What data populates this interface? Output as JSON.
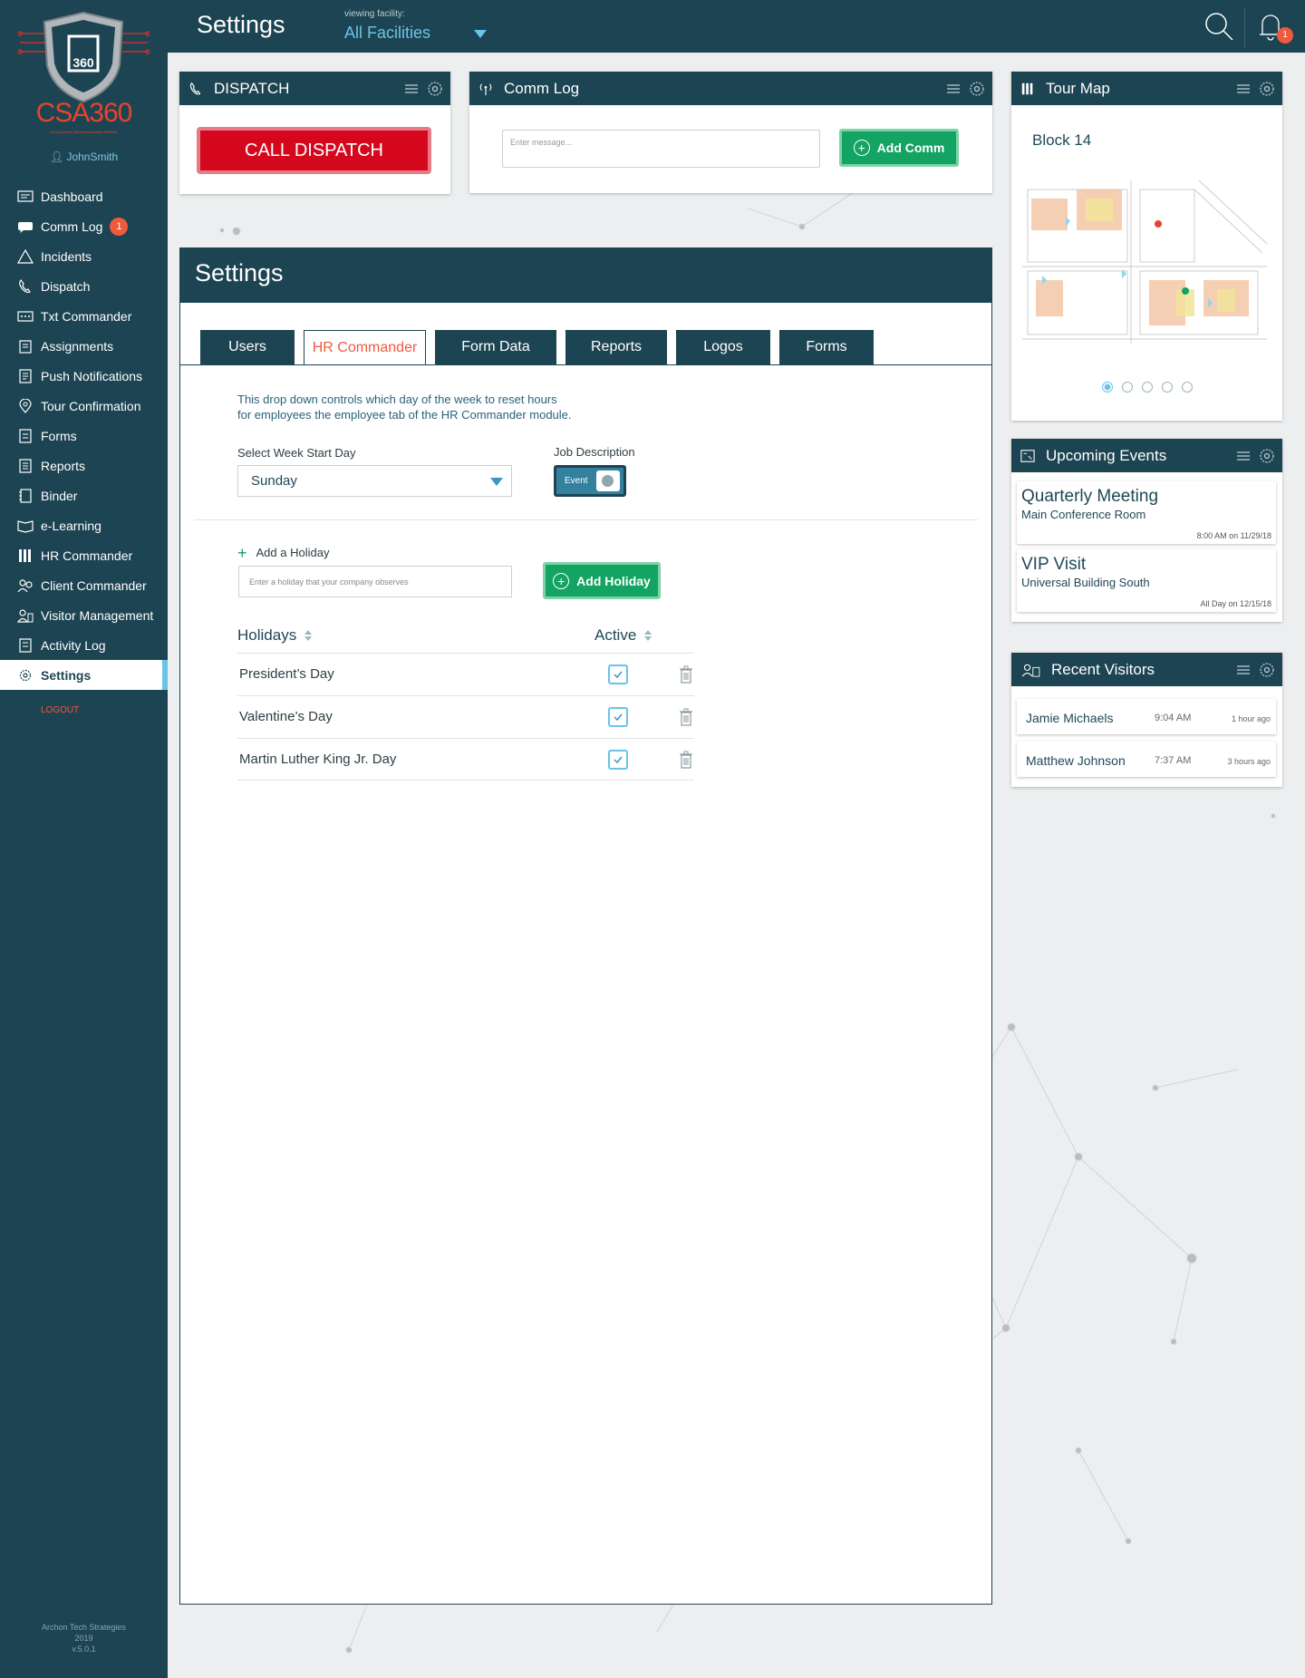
{
  "sidebar": {
    "brand": "CSA360",
    "brand_sub": "Ground Level Client Assessment Platform",
    "user": "JohnSmith",
    "items": [
      {
        "label": "Dashboard",
        "icon": "dashboard-icon"
      },
      {
        "label": "Comm Log",
        "icon": "chat-icon",
        "badge": "1"
      },
      {
        "label": "Incidents",
        "icon": "warning-icon"
      },
      {
        "label": "Dispatch",
        "icon": "phone-icon"
      },
      {
        "label": "Txt Commander",
        "icon": "message-dots-icon"
      },
      {
        "label": "Assignments",
        "icon": "clipboard-icon"
      },
      {
        "label": "Push Notifications",
        "icon": "document-icon"
      },
      {
        "label": "Tour Confirmation",
        "icon": "map-pin-icon"
      },
      {
        "label": "Forms",
        "icon": "form-icon"
      },
      {
        "label": "Reports",
        "icon": "report-icon"
      },
      {
        "label": "Binder",
        "icon": "binder-icon"
      },
      {
        "label": "e-Learning",
        "icon": "book-icon"
      },
      {
        "label": "HR Commander",
        "icon": "hr-icon"
      },
      {
        "label": "Client Commander",
        "icon": "client-icon"
      },
      {
        "label": "Visitor Management",
        "icon": "visitor-icon"
      },
      {
        "label": "Activity Log",
        "icon": "activity-icon"
      },
      {
        "label": "Settings",
        "icon": "gear-icon",
        "active": true
      }
    ],
    "logout": "LOGOUT",
    "footer": [
      "Archon Tech Strategies",
      "2019",
      "v.5.0.1"
    ]
  },
  "topbar": {
    "title": "Settings",
    "facility_label": "viewing facility:",
    "facility_value": "All Facilities",
    "notifications": "1"
  },
  "dispatch": {
    "title": "DISPATCH",
    "button": "CALL DISPATCH"
  },
  "comm_log": {
    "title": "Comm Log",
    "placeholder": "Enter message...",
    "button": "Add Comm"
  },
  "tour_map": {
    "title": "Tour Map",
    "label": "Block 14",
    "pages": 5,
    "active_page": 1
  },
  "upcoming_events": {
    "title": "Upcoming Events",
    "events": [
      {
        "title": "Quarterly Meeting",
        "location": "Main Conference Room",
        "time": "8:00 AM on 11/29/18"
      },
      {
        "title": "VIP Visit",
        "location": "Universal Building South",
        "time": "All Day on 12/15/18"
      }
    ]
  },
  "recent_visitors": {
    "title": "Recent Visitors",
    "visitors": [
      {
        "name": "Jamie Michaels",
        "time": "9:04 AM",
        "ago": "1 hour ago"
      },
      {
        "name": "Matthew Johnson",
        "time": "7:37 AM",
        "ago": "3 hours ago"
      }
    ]
  },
  "settings": {
    "title": "Settings",
    "tabs": [
      {
        "label": "Users"
      },
      {
        "label": "HR Commander",
        "active": true
      },
      {
        "label": "Form Data"
      },
      {
        "label": "Reports"
      },
      {
        "label": "Logos"
      },
      {
        "label": "Forms"
      }
    ],
    "description_line1": "This drop down controls which day of the week to reset hours",
    "description_line2": "for employees the employee tab of the HR Commander module.",
    "week_start_label": "Select Week Start Day",
    "week_start_value": "Sunday",
    "job_description_label": "Job Description",
    "toggle_label": "Event",
    "add_holiday_label": "Add a Holiday",
    "holiday_placeholder": "Enter a holiday that your company observes",
    "add_holiday_button": "Add Holiday",
    "col_holidays": "Holidays",
    "col_active": "Active",
    "holidays": [
      {
        "name": "President’s Day",
        "active": true
      },
      {
        "name": "Valentine’s Day",
        "active": true
      },
      {
        "name": "Martin Luther King Jr. Day",
        "active": true
      }
    ]
  },
  "colors": {
    "navy": "#1d4452",
    "accent_orange": "#f05a3c",
    "accent_blue": "#6cc3e8",
    "green": "#13a363",
    "red": "#d4071d"
  }
}
